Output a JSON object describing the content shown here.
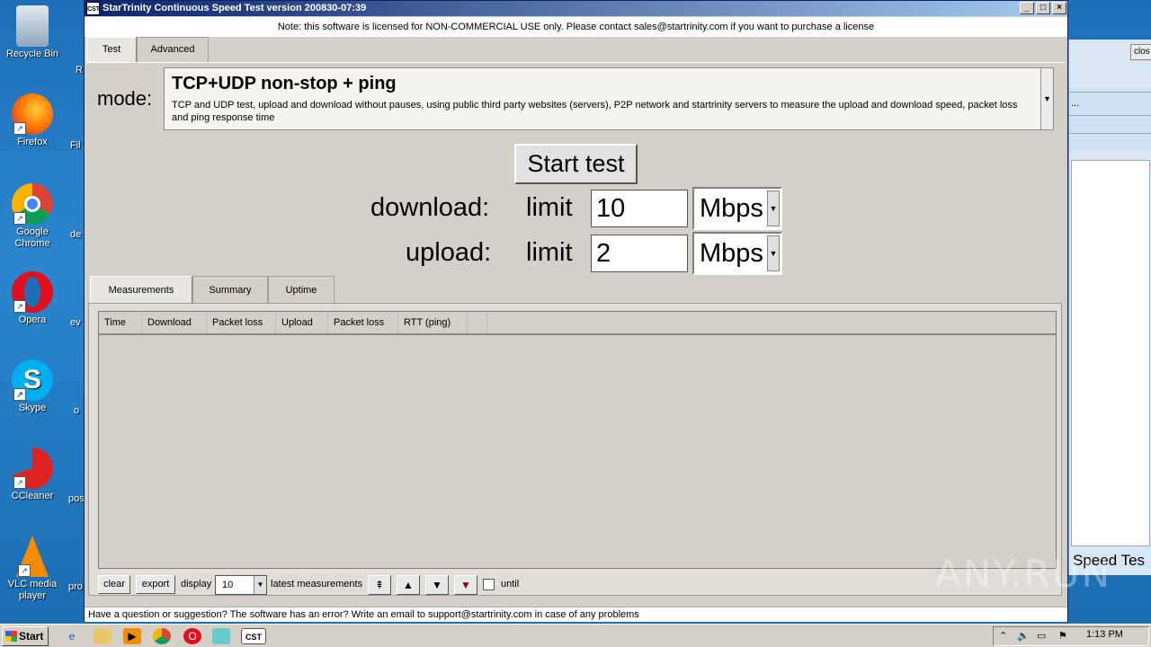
{
  "desktop": {
    "icons": [
      {
        "label": "Recycle Bin"
      },
      {
        "label": "Firefox"
      },
      {
        "label": "Google Chrome"
      },
      {
        "label": "Opera"
      },
      {
        "label": "Skype"
      },
      {
        "label": "CCleaner"
      },
      {
        "label": "VLC media player"
      }
    ],
    "partial_labels": [
      "R",
      "Fil",
      "de",
      "ev",
      "o",
      "pos",
      "pro"
    ]
  },
  "background_window": {
    "close_label": "clos",
    "ellipsis": "...",
    "bottom_text": "Speed Tes"
  },
  "window": {
    "title": "StarTrinity Continuous Speed Test version 200830-07:39",
    "icon_text": "CST",
    "notice": "Note: this software is licensed for NON-COMMERCIAL USE only. Please contact sales@startrinity.com if you want to purchase a license",
    "top_tabs": [
      "Test",
      "Advanced"
    ],
    "mode_label": "mode:",
    "mode_title": "TCP+UDP non-stop + ping",
    "mode_description": "TCP and UDP test, upload and download without pauses, using public third party websites (servers), P2P network and startrinity servers to measure the upload and download speed, packet loss and ping response time",
    "start_button": "Start test",
    "download_label": "download:",
    "upload_label": "upload:",
    "limit_label": "limit",
    "download_limit": "10",
    "upload_limit": "2",
    "download_unit": "Mbps",
    "upload_unit": "Mbps",
    "result_tabs": [
      "Measurements",
      "Summary",
      "Uptime"
    ],
    "columns": [
      "Time",
      "Download",
      "Packet loss",
      "Upload",
      "Packet loss",
      "RTT (ping)"
    ],
    "rows": [],
    "clear_button": "clear",
    "export_button": "export",
    "display_label": "display",
    "display_value": "10",
    "latest_label": "latest measurements",
    "until_label": "until",
    "until_checked": false,
    "footer": "Have a question or suggestion? The software has an error? Write an email to support@startrinity.com in case of any problems"
  },
  "taskbar": {
    "start_label": "Start",
    "active_app": "CST",
    "clock": "1:13 PM"
  },
  "watermark": "ANY.RUN"
}
